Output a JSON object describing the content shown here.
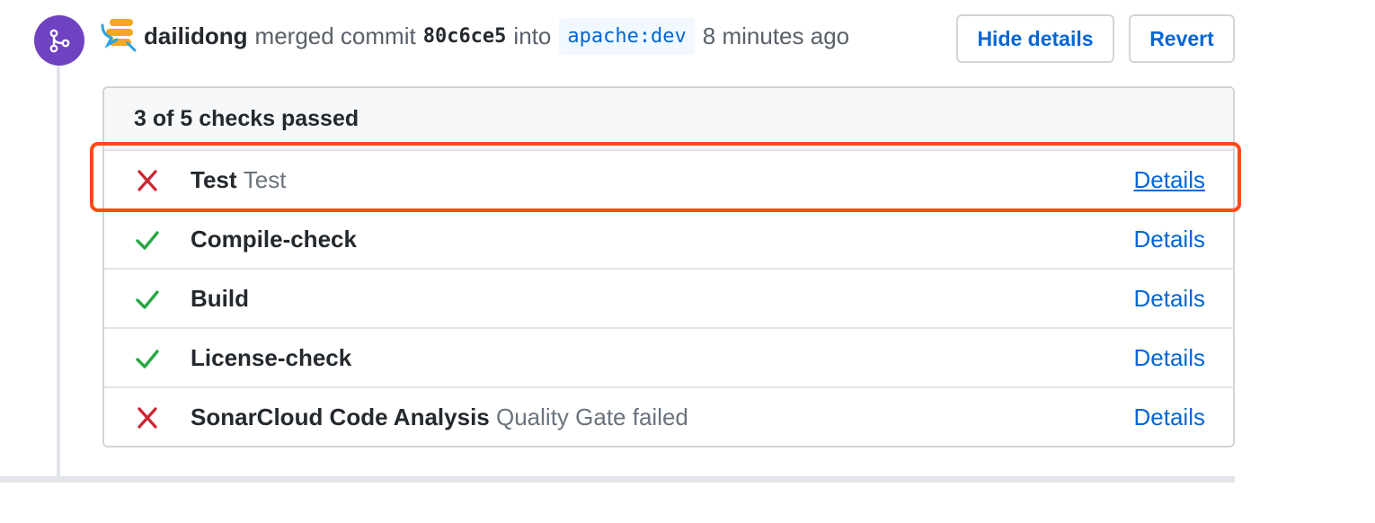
{
  "event": {
    "author": "dailidong",
    "action": "merged commit",
    "commit_sha": "80c6ce5",
    "into_word": "into",
    "branch": "apache:dev",
    "time_ago": "8 minutes ago"
  },
  "buttons": {
    "hide_details": "Hide details",
    "revert": "Revert"
  },
  "checks": {
    "summary": "3 of 5 checks passed",
    "items": [
      {
        "name": "Test",
        "description": "Test",
        "status": "failed",
        "details_label": "Details"
      },
      {
        "name": "Compile-check",
        "description": "",
        "status": "passed",
        "details_label": "Details"
      },
      {
        "name": "Build",
        "description": "",
        "status": "passed",
        "details_label": "Details"
      },
      {
        "name": "License-check",
        "description": "",
        "status": "passed",
        "details_label": "Details"
      },
      {
        "name": "SonarCloud Code Analysis",
        "description": "Quality Gate failed",
        "status": "failed",
        "details_label": "Details"
      }
    ]
  },
  "icons": {
    "merge": "git-merge-icon",
    "failed": "x-icon",
    "passed": "check-icon"
  },
  "colors": {
    "merge_badge": "#6f42c1",
    "link": "#0366d6",
    "failed": "#cb2431",
    "passed": "#28a745",
    "highlight": "#ff4a16"
  }
}
